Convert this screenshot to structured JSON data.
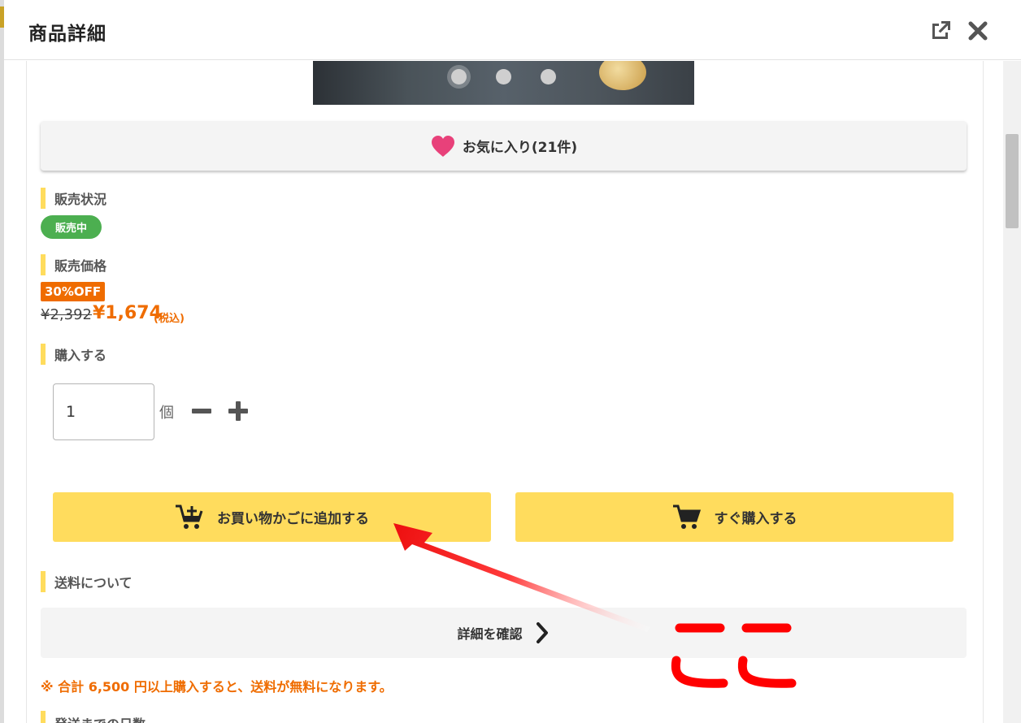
{
  "header": {
    "title": "商品詳細"
  },
  "carousel": {
    "dot_count": 3,
    "active_index": 0
  },
  "favorite": {
    "label": "お気に入り(21件)",
    "heart_color": "#e8417a"
  },
  "sales_status": {
    "heading": "販売状況",
    "badge": "販売中"
  },
  "price": {
    "heading": "販売価格",
    "discount_badge": "30%OFF",
    "original": "¥2,392",
    "current": "¥1,674",
    "tax_note": "(税込)"
  },
  "purchase": {
    "heading": "購入する",
    "quantity": "1",
    "unit": "個",
    "add_to_cart_label": "お買い物かごに追加する",
    "buy_now_label": "すぐ購入する"
  },
  "shipping": {
    "heading": "送料について",
    "detail_label": "詳細を確認",
    "free_shipping_note": "※ 合計 6,500 円以上購入すると、送料が無料になります。"
  },
  "delivery": {
    "heading": "発送までの日数"
  },
  "annotation": {
    "text": "ここ",
    "color": "#ff0000"
  },
  "colors": {
    "accent_yellow": "#ffdc5d",
    "sale_green": "#4caf50",
    "discount_orange": "#ef6c00"
  }
}
